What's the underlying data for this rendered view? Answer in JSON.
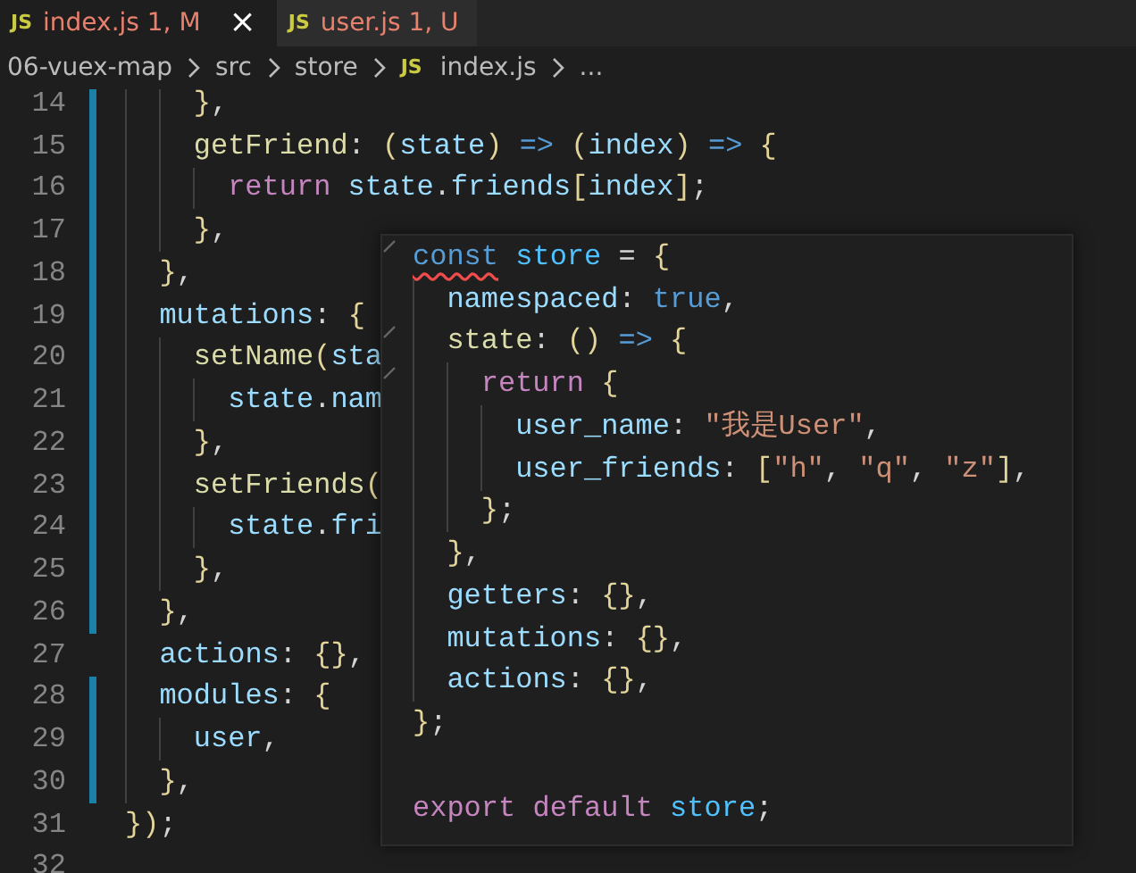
{
  "tabs": [
    {
      "icon": "JS",
      "label": "index.js",
      "status": "1, M",
      "selected": true,
      "close": "×"
    },
    {
      "icon": "JS",
      "label": "user.js",
      "status": "1, U",
      "selected": false
    }
  ],
  "breadcrumb": [
    {
      "text": "06-vuex-map"
    },
    {
      "text": "src"
    },
    {
      "text": "store"
    },
    {
      "icon": "JS",
      "text": "index.js"
    },
    {
      "text": "..."
    }
  ],
  "editor": {
    "lines": [
      {
        "number": "14",
        "changed": true,
        "tokens": [
          {
            "text": "    }",
            "kind": "brace"
          },
          {
            "text": ",",
            "kind": "punct"
          }
        ]
      },
      {
        "number": "15",
        "changed": true,
        "tokens": [
          {
            "text": "    getFriend",
            "kind": "fn"
          },
          {
            "text": ": ",
            "kind": "punct"
          },
          {
            "text": "(",
            "kind": "brace"
          },
          {
            "text": "state",
            "kind": "param"
          },
          {
            "text": ") ",
            "kind": "brace"
          },
          {
            "text": "=> ",
            "kind": "kw"
          },
          {
            "text": "(",
            "kind": "brace"
          },
          {
            "text": "index",
            "kind": "param"
          },
          {
            "text": ") ",
            "kind": "brace"
          },
          {
            "text": "=> ",
            "kind": "kw"
          },
          {
            "text": "{",
            "kind": "brace"
          }
        ]
      },
      {
        "number": "16",
        "changed": true,
        "tokens": [
          {
            "text": "      return ",
            "kind": "ctrl"
          },
          {
            "text": "state",
            "kind": "param"
          },
          {
            "text": ".",
            "kind": "punct"
          },
          {
            "text": "friends",
            "kind": "prop"
          },
          {
            "text": "[",
            "kind": "brace"
          },
          {
            "text": "index",
            "kind": "param"
          },
          {
            "text": "]",
            "kind": "brace"
          },
          {
            "text": ";",
            "kind": "punct"
          }
        ]
      },
      {
        "number": "17",
        "changed": true,
        "tokens": [
          {
            "text": "    }",
            "kind": "brace"
          },
          {
            "text": ",",
            "kind": "punct"
          }
        ]
      },
      {
        "number": "18",
        "changed": true,
        "tokens": [
          {
            "text": "  }",
            "kind": "brace"
          },
          {
            "text": ",",
            "kind": "punct"
          }
        ]
      },
      {
        "number": "19",
        "changed": true,
        "tokens": [
          {
            "text": "  mutations",
            "kind": "prop"
          },
          {
            "text": ": ",
            "kind": "punct"
          },
          {
            "text": "{",
            "kind": "brace"
          }
        ]
      },
      {
        "number": "20",
        "changed": true,
        "tokens": [
          {
            "text": "    setName",
            "kind": "fn"
          },
          {
            "text": "(",
            "kind": "brace"
          },
          {
            "text": "sta",
            "kind": "param"
          }
        ]
      },
      {
        "number": "21",
        "changed": true,
        "tokens": [
          {
            "text": "      state",
            "kind": "param"
          },
          {
            "text": ".",
            "kind": "punct"
          },
          {
            "text": "nam",
            "kind": "prop"
          }
        ]
      },
      {
        "number": "22",
        "changed": true,
        "tokens": [
          {
            "text": "    }",
            "kind": "brace"
          },
          {
            "text": ",",
            "kind": "punct"
          }
        ]
      },
      {
        "number": "23",
        "changed": true,
        "tokens": [
          {
            "text": "    setFriends",
            "kind": "fn"
          },
          {
            "text": "(",
            "kind": "brace"
          }
        ]
      },
      {
        "number": "24",
        "changed": true,
        "tokens": [
          {
            "text": "      state",
            "kind": "param"
          },
          {
            "text": ".",
            "kind": "punct"
          },
          {
            "text": "fri",
            "kind": "prop"
          }
        ]
      },
      {
        "number": "25",
        "changed": true,
        "tokens": [
          {
            "text": "    }",
            "kind": "brace"
          },
          {
            "text": ",",
            "kind": "punct"
          }
        ]
      },
      {
        "number": "26",
        "changed": true,
        "tokens": [
          {
            "text": "  }",
            "kind": "brace"
          },
          {
            "text": ",",
            "kind": "punct"
          }
        ]
      },
      {
        "number": "27",
        "changed": false,
        "tokens": [
          {
            "text": "  actions",
            "kind": "prop"
          },
          {
            "text": ": ",
            "kind": "punct"
          },
          {
            "text": "{}",
            "kind": "brace"
          },
          {
            "text": ",",
            "kind": "punct"
          }
        ]
      },
      {
        "number": "28",
        "changed": true,
        "tokens": [
          {
            "text": "  modules",
            "kind": "prop"
          },
          {
            "text": ": ",
            "kind": "punct"
          },
          {
            "text": "{",
            "kind": "brace"
          }
        ]
      },
      {
        "number": "29",
        "changed": true,
        "tokens": [
          {
            "text": "    user",
            "kind": "prop"
          },
          {
            "text": ",",
            "kind": "punct"
          }
        ]
      },
      {
        "number": "30",
        "changed": true,
        "tokens": [
          {
            "text": "  }",
            "kind": "brace"
          },
          {
            "text": ",",
            "kind": "punct"
          }
        ]
      },
      {
        "number": "31",
        "changed": false,
        "tokens": [
          {
            "text": "})",
            "kind": "brace"
          },
          {
            "text": ";",
            "kind": "punct"
          }
        ]
      },
      {
        "number": "32",
        "changed": false
      }
    ]
  },
  "hover": {
    "lines": [
      {
        "tick": true,
        "squiggle": true,
        "tokens": [
          {
            "text": "const",
            "kind": "kw"
          },
          {
            "text": " store",
            "kind": "var"
          },
          {
            "text": " = ",
            "kind": "punct"
          },
          {
            "text": "{",
            "kind": "brace"
          }
        ]
      },
      {
        "tick": false,
        "squiggle": false,
        "tokens": [
          {
            "text": "  namespaced",
            "kind": "prop"
          },
          {
            "text": ": ",
            "kind": "punct"
          },
          {
            "text": "true",
            "kind": "kw"
          },
          {
            "text": ",",
            "kind": "punct"
          }
        ]
      },
      {
        "tick": true,
        "squiggle": false,
        "tokens": [
          {
            "text": "  state",
            "kind": "fn"
          },
          {
            "text": ": ",
            "kind": "punct"
          },
          {
            "text": "() ",
            "kind": "brace"
          },
          {
            "text": "=> ",
            "kind": "kw"
          },
          {
            "text": "{",
            "kind": "brace"
          }
        ]
      },
      {
        "tick": true,
        "squiggle": false,
        "tokens": [
          {
            "text": "    return ",
            "kind": "ctrl"
          },
          {
            "text": "{",
            "kind": "brace"
          }
        ]
      },
      {
        "tick": false,
        "squiggle": false,
        "tokens": [
          {
            "text": "      user_name",
            "kind": "prop"
          },
          {
            "text": ": ",
            "kind": "punct"
          },
          {
            "text": "\"我是User\"",
            "kind": "str"
          },
          {
            "text": ",",
            "kind": "punct"
          }
        ]
      },
      {
        "tick": false,
        "squiggle": false,
        "tokens": [
          {
            "text": "      user_friends",
            "kind": "prop"
          },
          {
            "text": ": ",
            "kind": "punct"
          },
          {
            "text": "[",
            "kind": "brace"
          },
          {
            "text": "\"h\"",
            "kind": "str"
          },
          {
            "text": ", ",
            "kind": "punct"
          },
          {
            "text": "\"q\"",
            "kind": "str"
          },
          {
            "text": ", ",
            "kind": "punct"
          },
          {
            "text": "\"z\"",
            "kind": "str"
          },
          {
            "text": "]",
            "kind": "brace"
          },
          {
            "text": ",",
            "kind": "punct"
          }
        ]
      },
      {
        "tick": false,
        "squiggle": false,
        "tokens": [
          {
            "text": "    }",
            "kind": "brace"
          },
          {
            "text": ";",
            "kind": "punct"
          }
        ]
      },
      {
        "tick": false,
        "squiggle": false,
        "tokens": [
          {
            "text": "  }",
            "kind": "brace"
          },
          {
            "text": ",",
            "kind": "punct"
          }
        ]
      },
      {
        "tick": false,
        "squiggle": false,
        "tokens": [
          {
            "text": "  getters",
            "kind": "prop"
          },
          {
            "text": ": ",
            "kind": "punct"
          },
          {
            "text": "{}",
            "kind": "brace"
          },
          {
            "text": ",",
            "kind": "punct"
          }
        ]
      },
      {
        "tick": false,
        "squiggle": false,
        "tokens": [
          {
            "text": "  mutations",
            "kind": "prop"
          },
          {
            "text": ": ",
            "kind": "punct"
          },
          {
            "text": "{}",
            "kind": "brace"
          },
          {
            "text": ",",
            "kind": "punct"
          }
        ]
      },
      {
        "tick": false,
        "squiggle": false,
        "tokens": [
          {
            "text": "  actions",
            "kind": "prop"
          },
          {
            "text": ": ",
            "kind": "punct"
          },
          {
            "text": "{}",
            "kind": "brace"
          },
          {
            "text": ",",
            "kind": "punct"
          }
        ]
      },
      {
        "tick": false,
        "squiggle": false,
        "tokens": [
          {
            "text": "}",
            "kind": "brace"
          },
          {
            "text": ";",
            "kind": "punct"
          }
        ]
      },
      {
        "tick": false,
        "squiggle": false
      },
      {
        "tick": false,
        "squiggle": false,
        "tokens": [
          {
            "text": "export ",
            "kind": "ctrl"
          },
          {
            "text": "default ",
            "kind": "ctrl"
          },
          {
            "text": "store",
            "kind": "var"
          },
          {
            "text": ";",
            "kind": "punct"
          }
        ]
      }
    ]
  }
}
